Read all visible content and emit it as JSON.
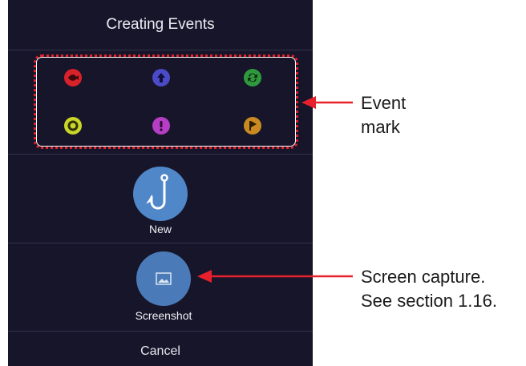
{
  "dialog": {
    "title": "Creating Events",
    "new_label": "New",
    "screenshot_label": "Screenshot",
    "cancel_label": "Cancel"
  },
  "event_marks": [
    {
      "icon": "fish-icon",
      "color": "#d8222b"
    },
    {
      "icon": "up-arrow-icon",
      "color": "#4b4bc8"
    },
    {
      "icon": "recycle-icon",
      "color": "#2f9a3d"
    },
    {
      "icon": "ring-icon",
      "color": "#c9d628"
    },
    {
      "icon": "exclamation-icon",
      "color": "#b53ec4"
    },
    {
      "icon": "flag-icon",
      "color": "#c98a22"
    }
  ],
  "callouts": {
    "event_mark_line1": "Event",
    "event_mark_line2": "mark",
    "screenshot_line1": "Screen capture.",
    "screenshot_line2": "See section 1.16."
  },
  "colors": {
    "dialog_bg": "#171529",
    "button_blue": "#4f87c9",
    "highlight_red": "#e8202c"
  }
}
